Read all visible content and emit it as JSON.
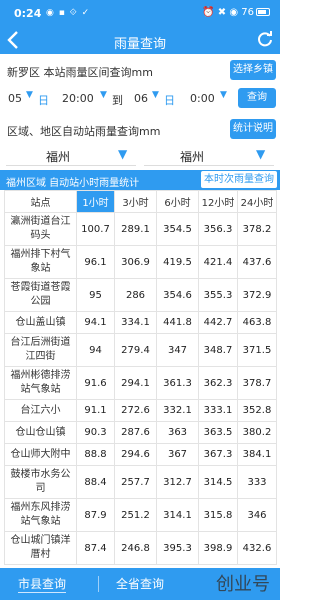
{
  "status": {
    "time": "0:24",
    "icons": "◉ ▪ ⟐ ✓",
    "right": "⏰ ✖ ◉ 76"
  },
  "title": "雨量查询",
  "station_query": {
    "label": "新罗区 本站雨量区间查询mm",
    "button": "选择乡镇"
  },
  "date_range": {
    "start_day": "05",
    "start_time": "20:00",
    "separator": "到",
    "end_day": "06",
    "end_time": "0:00",
    "query_button": "查询"
  },
  "region_section": {
    "label": "区域、地区自动站雨量查询mm",
    "help_button": "统计说明"
  },
  "dropdowns": {
    "left": "福州",
    "right": "福州"
  },
  "stats_header": {
    "left": "福州区域 自动站小时雨量统计",
    "right": "本时次雨量查询"
  },
  "table": {
    "headers": [
      "站点",
      "1小时",
      "3小时",
      "6小时",
      "12小时",
      "24小时"
    ],
    "rows": [
      [
        "瀛洲街道台江码头",
        "100.7",
        "289.1",
        "354.5",
        "356.3",
        "378.2"
      ],
      [
        "福州排下村气象站",
        "96.1",
        "306.9",
        "419.5",
        "421.4",
        "437.6"
      ],
      [
        "苍霞街道苍霞公园",
        "95",
        "286",
        "354.6",
        "355.3",
        "372.9"
      ],
      [
        "仓山盖山镇",
        "94.1",
        "334.1",
        "441.8",
        "442.7",
        "463.8"
      ],
      [
        "台江后洲街道江四街",
        "94",
        "279.4",
        "347",
        "348.7",
        "371.5"
      ],
      [
        "福州彬德排涝站气象站",
        "91.6",
        "294.1",
        "361.3",
        "362.3",
        "378.7"
      ],
      [
        "台江六小",
        "91.1",
        "272.6",
        "332.1",
        "333.1",
        "352.8"
      ],
      [
        "仓山仓山镇",
        "90.3",
        "287.6",
        "363",
        "363.5",
        "380.2"
      ],
      [
        "仓山师大附中",
        "88.8",
        "294.6",
        "367",
        "367.3",
        "384.1"
      ],
      [
        "鼓楼市水务公司",
        "88.4",
        "257.7",
        "312.7",
        "314.5",
        "333"
      ],
      [
        "福州东风排涝站气象站",
        "87.9",
        "251.2",
        "314.1",
        "315.8",
        "346"
      ],
      [
        "仓山城门镇洋厝村",
        "87.4",
        "246.8",
        "395.3",
        "398.9",
        "432.6"
      ]
    ]
  },
  "tabs": {
    "city": "市县查询",
    "province": "全省查询"
  },
  "watermark": "创业号"
}
